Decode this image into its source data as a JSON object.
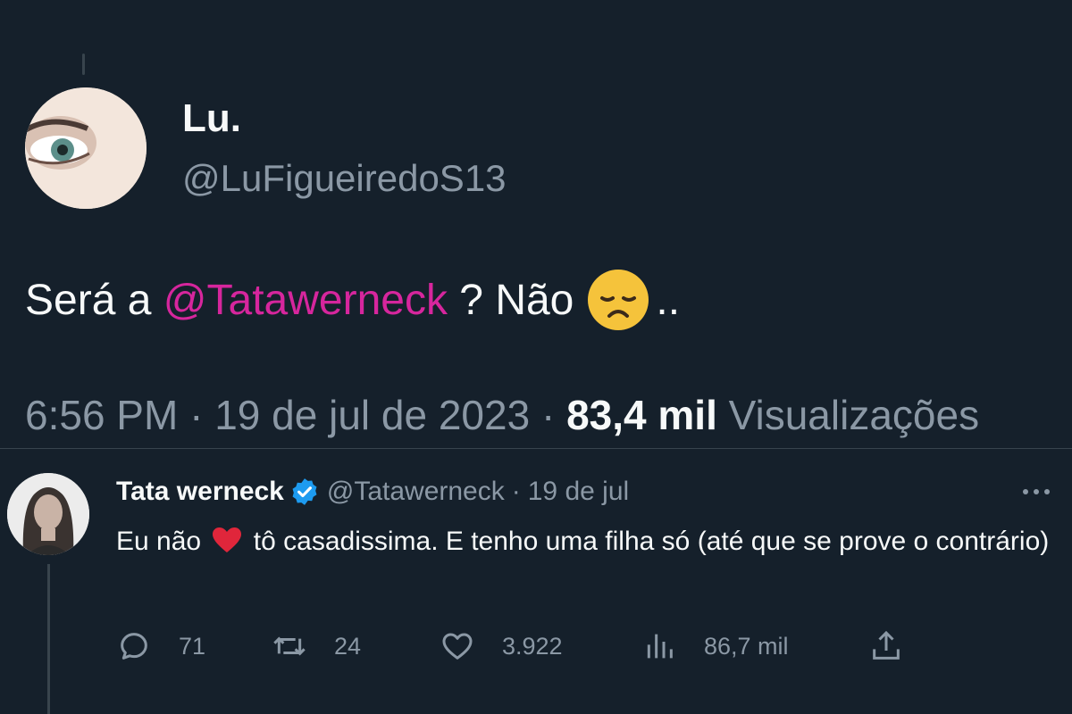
{
  "main_tweet": {
    "author_name": "Lu.",
    "author_handle": "@LuFigueiredoS13",
    "text_prefix": "Será a ",
    "mention": "@Tatawerneck",
    "text_middle": " ? Não",
    "text_suffix": "..",
    "emoji": "disappointed-face-emoji",
    "time": "6:56 PM",
    "date": "19 de jul de 2023",
    "views_count": "83,4 mil",
    "views_label": "Visualizações"
  },
  "reply": {
    "author_name": "Tata werneck",
    "author_handle": "@Tatawerneck",
    "separator": "·",
    "date": "19 de jul",
    "text_part1": "Eu não",
    "text_part2": "tô casadissima. E tenho uma filha só (até que se prove o contrário)",
    "emoji": "red-heart-emoji",
    "verified_icon": "verified-badge-icon",
    "actions": {
      "replies": "71",
      "retweets": "24",
      "likes": "3.922",
      "views": "86,7 mil"
    }
  },
  "colors": {
    "background": "#15202b",
    "mention": "#d6269d",
    "secondary_text": "#8b98a5",
    "verified": "#1d9bf0"
  }
}
